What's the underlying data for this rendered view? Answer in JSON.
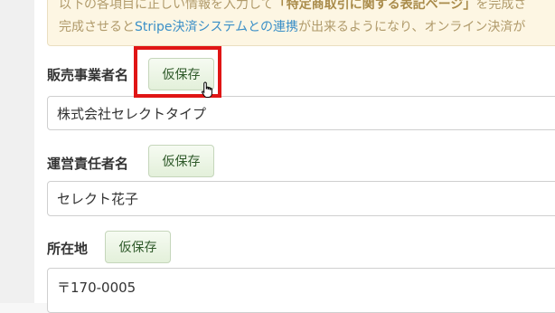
{
  "notice": {
    "line1_prefix": "以下の各項目に正しい情報を入力して",
    "line1_strong": "「特定商取引に関する表記ページ」",
    "line1_suffix": "を完成さ",
    "line2_prefix": "完成させると",
    "line2_link": "Stripe決済システムとの連携",
    "line2_suffix": "が出来るようになり、オンライン決済が"
  },
  "fields": [
    {
      "label": "販売事業者名",
      "button": "仮保存",
      "value": "株式会社セレクトタイプ"
    },
    {
      "label": "運営責任者名",
      "button": "仮保存",
      "value": "セレクト花子"
    },
    {
      "label": "所在地",
      "button": "仮保存",
      "value": "〒170-0005"
    }
  ]
}
